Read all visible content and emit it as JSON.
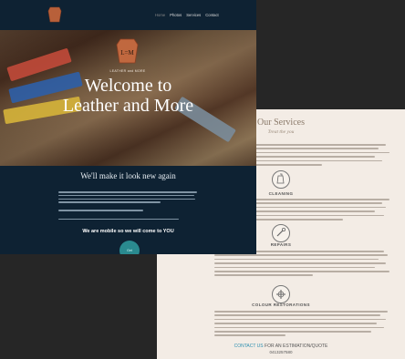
{
  "front": {
    "nav": {
      "items": [
        "Home",
        "Photos",
        "Services",
        "Contact"
      ]
    },
    "hero": {
      "logo_text": "LEATHER and MORE",
      "logo_monogram": "L=M",
      "title_line1": "Welcome to",
      "title_line2": "Leather and More"
    },
    "band": {
      "title": "We'll make it look new again",
      "tagline": "We are mobile so we will come to YOU",
      "button": "Get"
    }
  },
  "back": {
    "heading": "Our Services",
    "subheading": "Treat the you",
    "services": [
      {
        "title": "CLEANING",
        "icon": "cleaning-icon"
      },
      {
        "title": "REPAIRS",
        "icon": "repair-icon"
      },
      {
        "title": "COLOUR RESTORATIONS",
        "icon": "colour-icon"
      }
    ],
    "footer_label": "CONTACT US",
    "footer_text": "FOR AN ESTIMATION/QUOTE",
    "phone": "0413257580"
  },
  "colors": {
    "navy": "#0e2233",
    "cream": "#f3ece5",
    "accent": "#2c8fb0",
    "button": "#2a8a8f"
  }
}
